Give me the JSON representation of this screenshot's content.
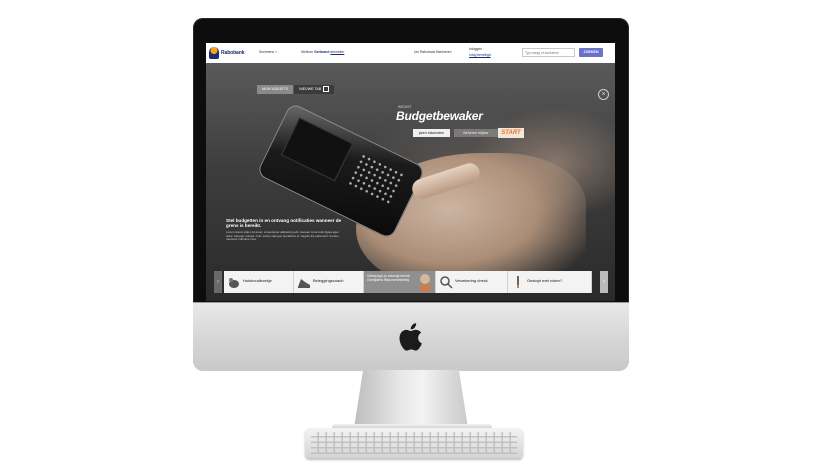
{
  "topbar": {
    "brand": "Rabobank",
    "menu_label": "Snelmenu",
    "welcome_prefix": "Welkom",
    "user_name": "Gerbrand",
    "logout_label": "afmelden",
    "banking_label": "Uw Rabobank Bankieren",
    "login_label": "Inloggen",
    "login_note": "Inlog beveiligd",
    "search_placeholder": "Typ vraag of zoekterm",
    "search_button": "ZOEKEN"
  },
  "tabs": [
    {
      "label": "MIJN WIDGETS"
    },
    {
      "label": "NIEUWE TAB"
    }
  ],
  "widget": {
    "label": "WIDGET",
    "title": "Budgetbewaker",
    "option_1": "jaren inkomsten",
    "option_2": "Beheren mijlaar",
    "start_label": "START"
  },
  "caption": {
    "heading": "Stel budgetten in en ontvang notificaties wanneer de grens is bereikt.",
    "body": "Lorem ipsum dolor sit amet, consectetur adipiscing elit. Aenean commodo ligula eget dolor. Aenean massa. Cum sociis natoque penatibus et magnis dis parturient montes, nascetur ridiculus mus."
  },
  "carousel": {
    "items": [
      {
        "label": "Huishoudboekje"
      },
      {
        "label": "Beleggingscoach"
      },
      {
        "label": "Onbezorgd zo ontzorgt met de Overlijdens Risicoverzekering"
      },
      {
        "label": "Verzekering check"
      },
      {
        "label": "Gestopt met roken?"
      }
    ]
  },
  "colors": {
    "brand_navy": "#1e2b6f",
    "brand_orange": "#f37021",
    "search_button": "#6b72c9"
  },
  "icons": {
    "close": "close-icon",
    "apple": "apple-logo-icon"
  }
}
